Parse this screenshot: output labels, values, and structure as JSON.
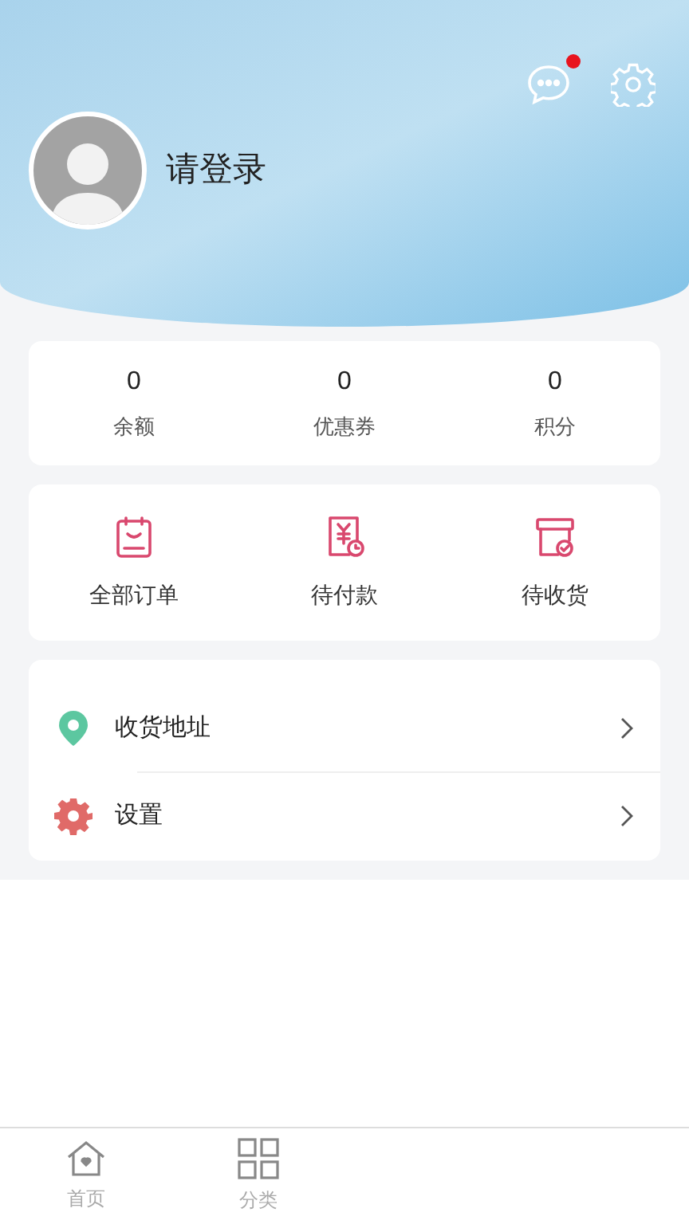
{
  "header": {
    "login_prompt": "请登录",
    "has_unread": true
  },
  "stats": [
    {
      "value": "0",
      "label": "余额"
    },
    {
      "value": "0",
      "label": "优惠券"
    },
    {
      "value": "0",
      "label": "积分"
    }
  ],
  "orders": [
    {
      "kind": "all",
      "label": "全部订单"
    },
    {
      "kind": "unpaid",
      "label": "待付款"
    },
    {
      "kind": "unreceived",
      "label": "待收货"
    }
  ],
  "menu": [
    {
      "kind": "address",
      "label": "收货地址"
    },
    {
      "kind": "settings",
      "label": "设置"
    }
  ],
  "tabbar": [
    {
      "kind": "home",
      "label": "首页",
      "selected": false
    },
    {
      "kind": "category",
      "label": "分类",
      "selected": false
    }
  ]
}
